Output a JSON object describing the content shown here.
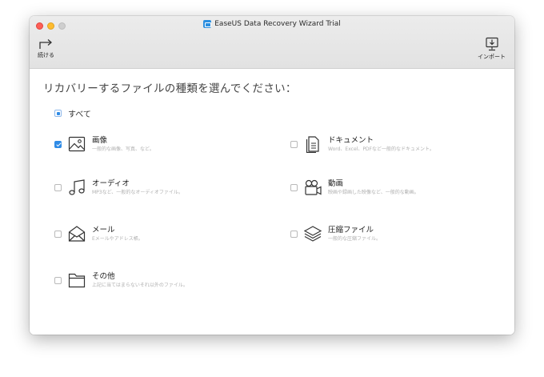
{
  "window": {
    "title": "EaseUS Data Recovery Wizard Trial"
  },
  "toolbar": {
    "continue_label": "続ける",
    "import_label": "インポート"
  },
  "main": {
    "heading": "リカバリーするファイルの種類を選んでください：",
    "select_all": {
      "label": "すべて",
      "state": "mixed"
    },
    "categories": [
      {
        "name": "画像",
        "desc": "一般的な画像、写真、など。",
        "checked": true,
        "icon": "image-icon"
      },
      {
        "name": "ドキュメント",
        "desc": "Word、Excel、PDFなど一般的なドキュメント。",
        "checked": false,
        "icon": "document-icon"
      },
      {
        "name": "オーディオ",
        "desc": "MP3など、一般的なオーディオファイル。",
        "checked": false,
        "icon": "music-note-icon"
      },
      {
        "name": "動画",
        "desc": "映画や録画した映像など、一般的な動画。",
        "checked": false,
        "icon": "video-camera-icon"
      },
      {
        "name": "メール",
        "desc": "Eメールやアドレス帳。",
        "checked": false,
        "icon": "envelope-icon"
      },
      {
        "name": "圧縮ファイル",
        "desc": "一般的な圧縮ファイル。",
        "checked": false,
        "icon": "layers-icon"
      },
      {
        "name": "その他",
        "desc": "上記に当てはまらないそれ以外のファイル。",
        "checked": false,
        "icon": "folder-icon"
      }
    ]
  },
  "colors": {
    "accent": "#2f8be6",
    "traffic_red": "#fe5f57",
    "traffic_yellow": "#febc2e",
    "traffic_gray": "#cfcfcf"
  }
}
